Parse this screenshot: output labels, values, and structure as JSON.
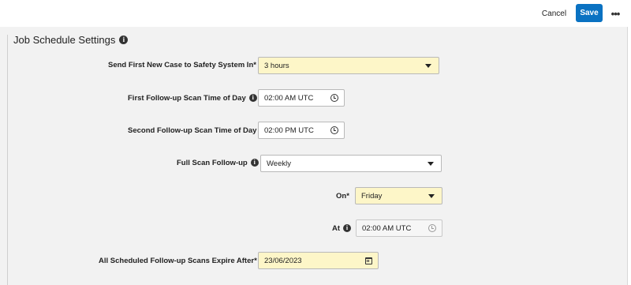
{
  "toolbar": {
    "cancel_label": "Cancel",
    "save_label": "Save",
    "more_label": "•••",
    "more_icon": "ellipsis-icon",
    "accent_color": "#0a72c2"
  },
  "section": {
    "title": "Job Schedule Settings",
    "info_icon": "info-icon",
    "info_glyph": "i"
  },
  "fields": {
    "send_first": {
      "label": "Send First New Case to Safety System In*",
      "value": "3 hours",
      "required": true,
      "control": "dropdown"
    },
    "first_followup": {
      "label": "First Follow-up Scan Time of Day",
      "value": "02:00 AM UTC",
      "has_info": true,
      "control": "time-picker"
    },
    "second_followup": {
      "label": "Second Follow-up Scan Time of Day",
      "value": "02:00 PM UTC",
      "control": "time-picker"
    },
    "full_scan": {
      "label": "Full Scan Follow-up",
      "value": "Weekly",
      "has_info": true,
      "control": "dropdown"
    },
    "on": {
      "label": "On*",
      "value": "Friday",
      "required": true,
      "control": "dropdown"
    },
    "at": {
      "label": "At",
      "value": "02:00 AM UTC",
      "has_info": true,
      "control": "time-picker"
    },
    "expire_after": {
      "label": "All Scheduled Follow-up Scans Expire After*",
      "value": "23/06/2023",
      "required": true,
      "control": "date-picker"
    }
  },
  "colors": {
    "required_field_bg": "#fdf6c8",
    "panel_bg": "#f2f2f2"
  }
}
